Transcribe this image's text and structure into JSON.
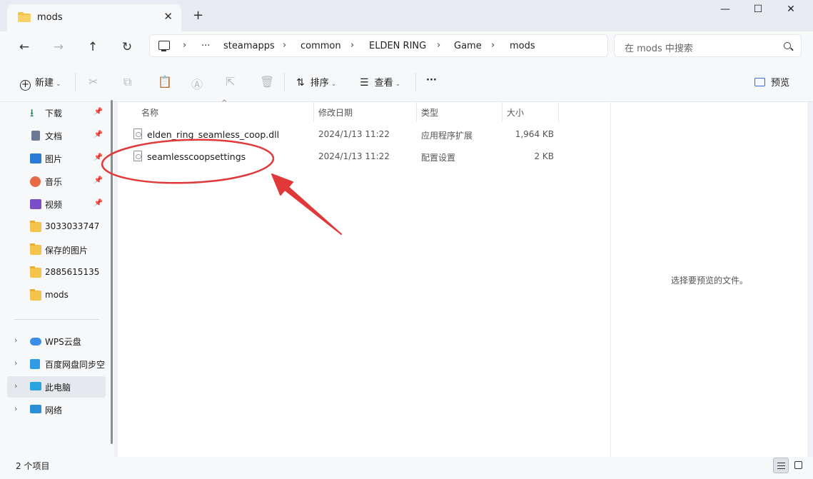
{
  "tab": {
    "title": "mods",
    "close_glyph": "✕",
    "new_glyph": "+"
  },
  "window": {
    "minimize": "—",
    "maximize": "☐",
    "close": "✕"
  },
  "nav": {
    "back": "←",
    "forward": "→",
    "up": "↑",
    "refresh": "↻"
  },
  "breadcrumb": {
    "more": "···",
    "sep": "›",
    "items": [
      "steamapps",
      "common",
      "ELDEN RING",
      "Game",
      "mods"
    ]
  },
  "search": {
    "placeholder": "在 mods 中搜索"
  },
  "toolbar": {
    "new_label": "新建",
    "sort_label": "排序",
    "view_label": "查看",
    "more_glyph": "···",
    "preview_label": "预览",
    "icons": [
      "cut-icon",
      "copy-icon",
      "paste-icon",
      "rename-icon",
      "share-icon",
      "delete-icon"
    ]
  },
  "sidebar": {
    "items": [
      {
        "label": "下载",
        "icon": "download-icon",
        "pinned": true
      },
      {
        "label": "文档",
        "icon": "documents-icon",
        "pinned": true
      },
      {
        "label": "图片",
        "icon": "pictures-icon",
        "pinned": true
      },
      {
        "label": "音乐",
        "icon": "music-icon",
        "pinned": true
      },
      {
        "label": "视频",
        "icon": "videos-icon",
        "pinned": true
      },
      {
        "label": "3033033747",
        "icon": "folder-icon"
      },
      {
        "label": "保存的图片",
        "icon": "folder-icon"
      },
      {
        "label": "2885615135",
        "icon": "folder-icon"
      },
      {
        "label": "mods",
        "icon": "folder-icon"
      }
    ],
    "locations": [
      {
        "label": "WPS云盘",
        "icon": "cloud-icon"
      },
      {
        "label": "百度网盘同步空",
        "icon": "baidu-sync-icon"
      },
      {
        "label": "此电脑",
        "icon": "this-pc-icon",
        "selected": true
      },
      {
        "label": "网络",
        "icon": "network-icon"
      }
    ]
  },
  "columns": {
    "name": "名称",
    "modified": "修改日期",
    "type": "类型",
    "size": "大小"
  },
  "files": [
    {
      "name": "elden_ring_seamless_coop.dll",
      "modified": "2024/1/13 11:22",
      "type": "应用程序扩展",
      "size": "1,964 KB"
    },
    {
      "name": "seamlesscoopsettings",
      "modified": "2024/1/13 11:22",
      "type": "配置设置",
      "size": "2 KB"
    }
  ],
  "preview": {
    "empty_text": "选择要预览的文件。"
  },
  "status": {
    "item_count": "2 个项目"
  },
  "colors": {
    "annotation": "#e0393a",
    "folder": "#f3c34c"
  }
}
